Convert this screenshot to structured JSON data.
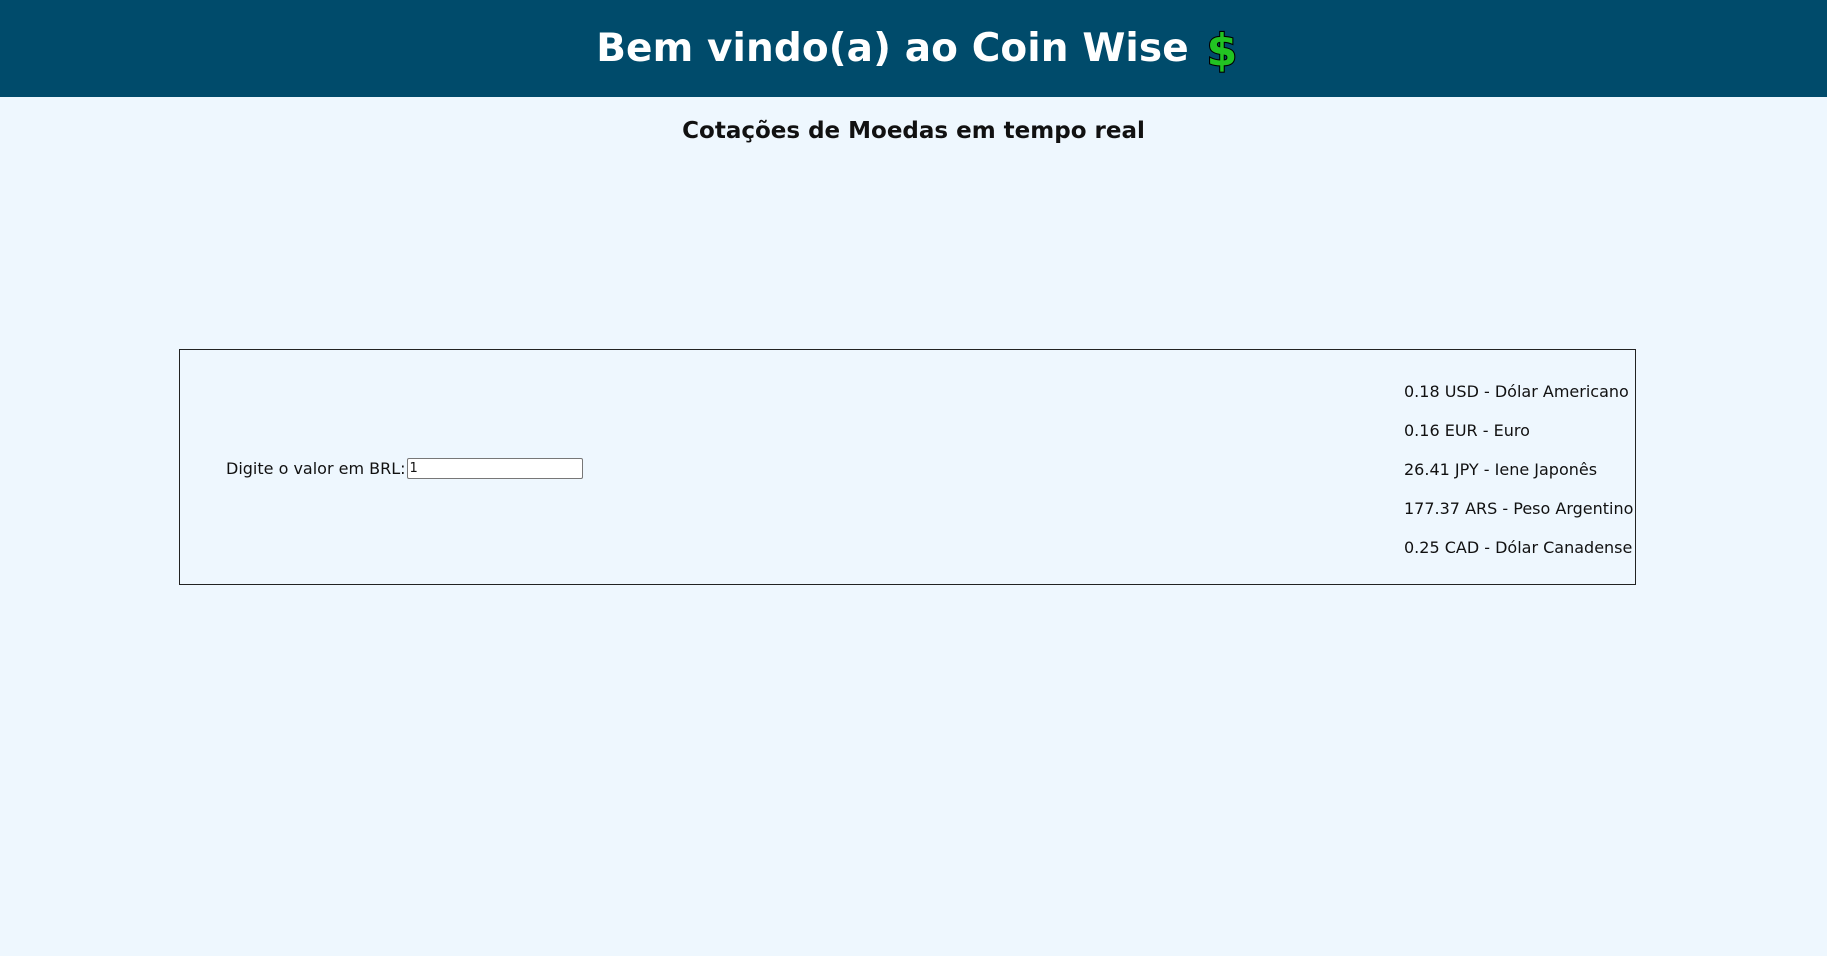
{
  "header": {
    "title": "Bem vindo(a) ao Coin Wise",
    "icon": "dollar-sign-icon",
    "background": "#004b6b",
    "icon_color": "#22c322"
  },
  "subtitle": "Cotações de Moedas em tempo real",
  "converter": {
    "label": "Digite o valor em BRL:",
    "value": "1"
  },
  "rates": [
    {
      "text": "0.18 USD - Dólar Americano"
    },
    {
      "text": "0.16 EUR - Euro"
    },
    {
      "text": "26.41 JPY - Iene Japonês"
    },
    {
      "text": "177.37 ARS - Peso Argentino"
    },
    {
      "text": "0.25 CAD - Dólar Canadense"
    }
  ]
}
